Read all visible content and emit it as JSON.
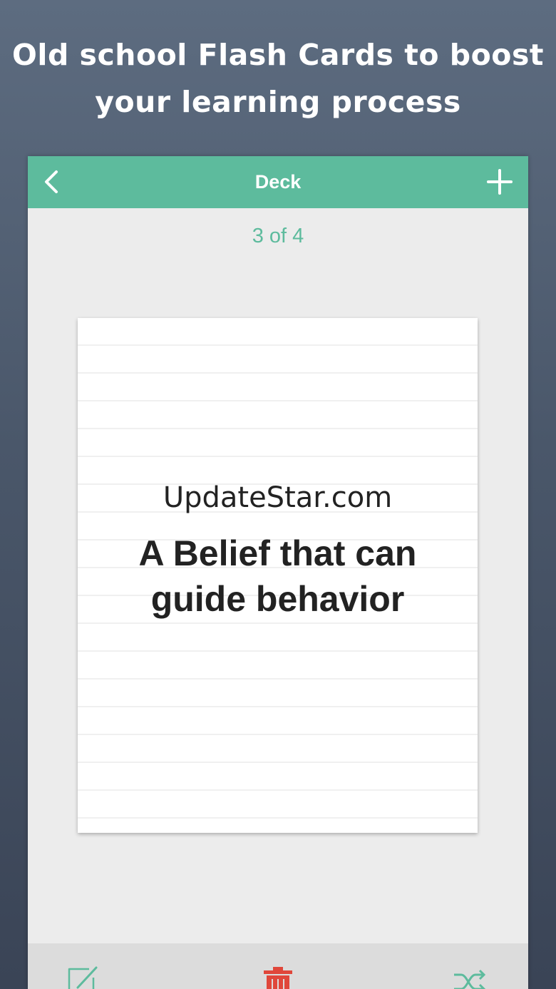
{
  "promo": {
    "line1": "Old school Flash Cards to boost",
    "line2": "your learning process"
  },
  "nav": {
    "title": "Deck",
    "back_icon": "chevron-left-icon",
    "add_icon": "plus-icon"
  },
  "counter": {
    "text": "3 of 4",
    "current": 3,
    "total": 4
  },
  "card": {
    "watermark": "UpdateStar.com",
    "text": "A Belief that can guide behavior"
  },
  "toolbar": {
    "edit_icon": "edit-icon",
    "delete_icon": "trash-icon",
    "shuffle_icon": "shuffle-icon"
  },
  "colors": {
    "accent": "#5dbb9d",
    "delete": "#e0473b",
    "background": "#4a576a"
  }
}
